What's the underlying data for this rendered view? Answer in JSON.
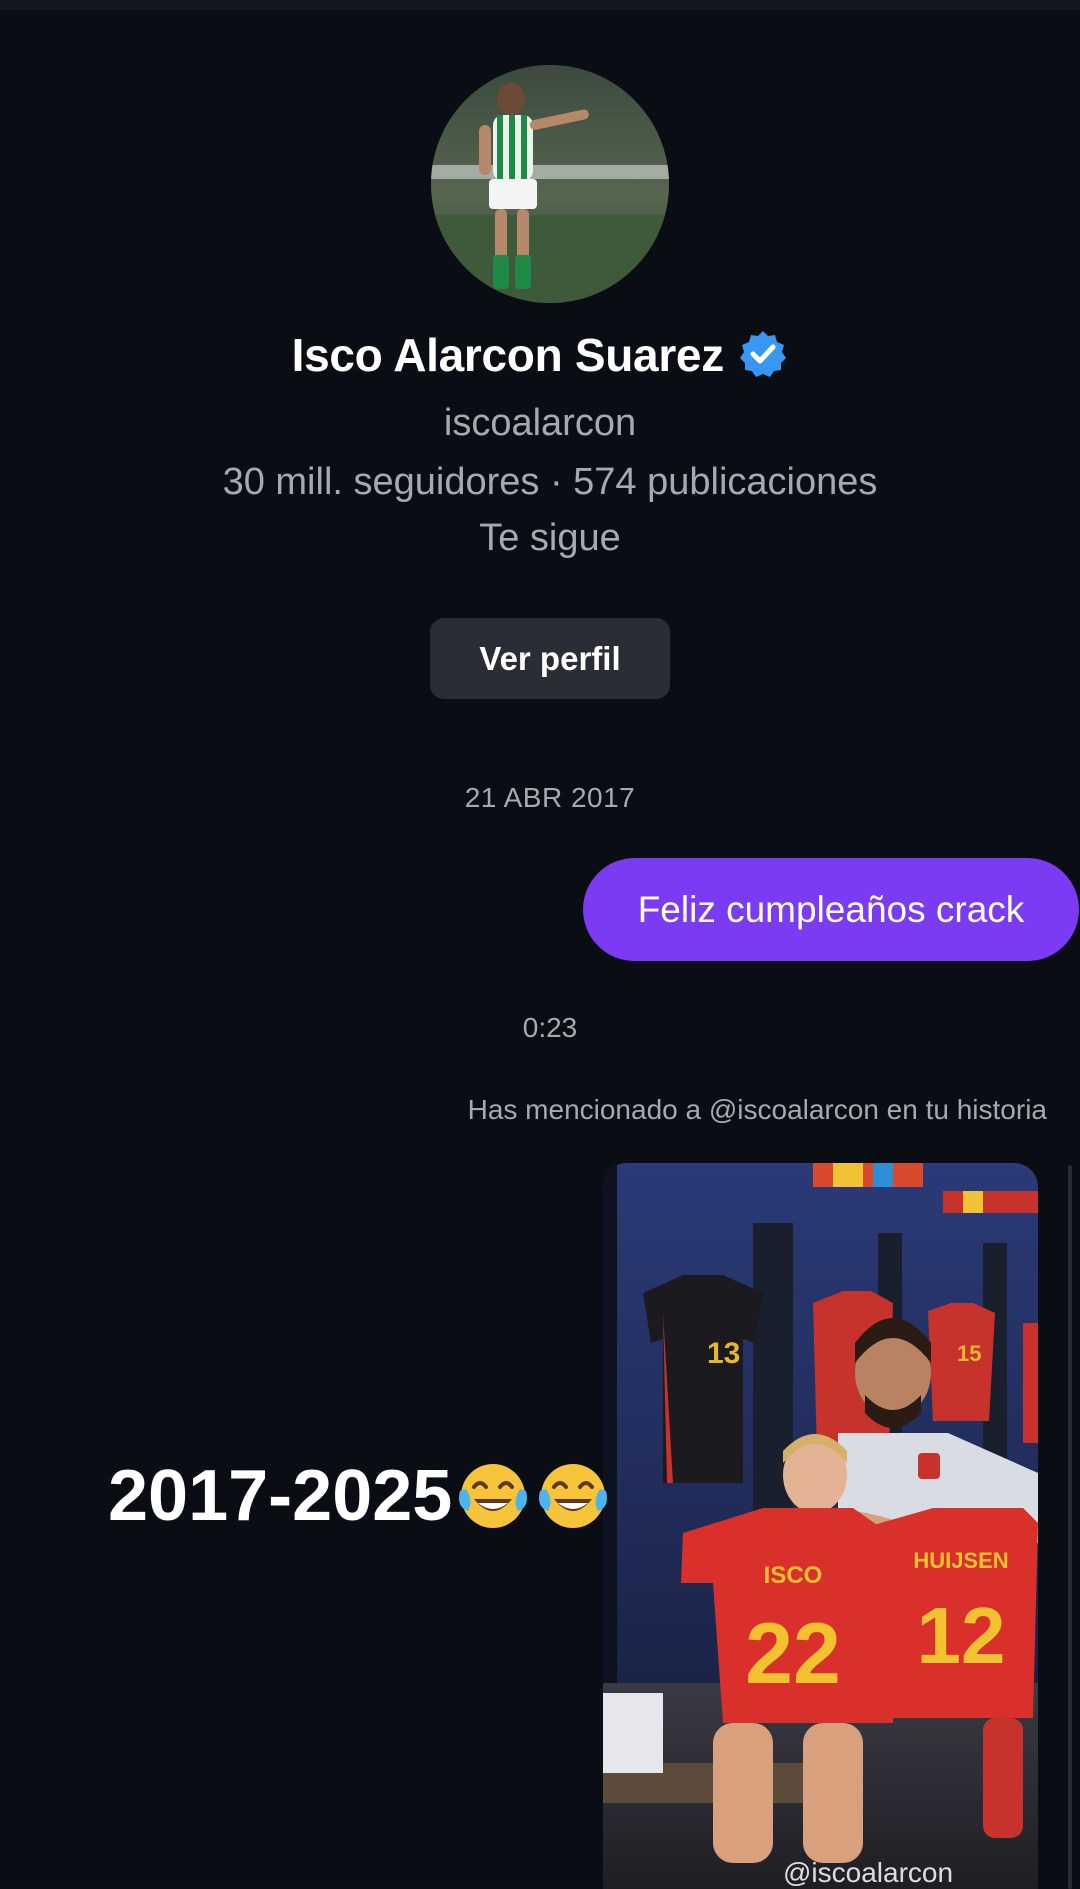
{
  "profile": {
    "name": "Isco Alarcon Suarez",
    "handle": "iscoalarcon",
    "stats": "30 mill. seguidores · 574 publicaciones",
    "follow_status": "Te sigue",
    "view_profile_label": "Ver perfil",
    "avatar_icon": "player-photo",
    "verified_icon": "verified-badge-icon"
  },
  "thread": {
    "date_label": "21 ABR 2017",
    "sent_message": "Feliz cumpleaños crack",
    "time_label": "0:23",
    "mention_note": "Has mencionado a @iscoalarcon en tu historia",
    "story_handle": "@iscoalarcon"
  },
  "caption": {
    "text": "2017-2025"
  },
  "story": {
    "left_shirt_name": "ISCO",
    "left_shirt_number": "22",
    "right_shirt_name": "HUIJSEN",
    "right_shirt_number": "12",
    "locker_number_left": "13",
    "locker_number_right": "15"
  },
  "colors": {
    "background": "#0b0d15",
    "bubble": "#7b3bf3",
    "button": "#2b2d36",
    "muted_text": "#a7a9b2",
    "verified": "#3897f0"
  }
}
